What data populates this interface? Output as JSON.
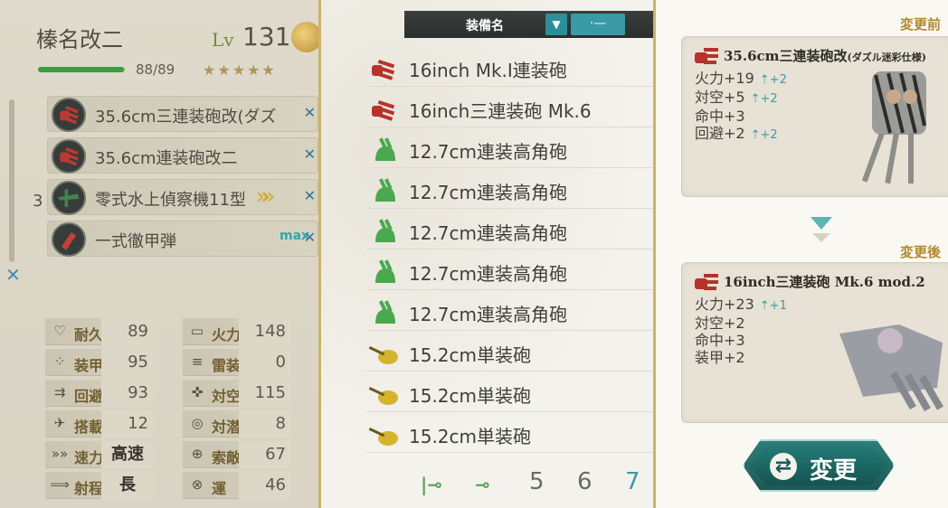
{
  "ship": {
    "name": "榛名改二",
    "lv_label": "Lv",
    "level": "131",
    "hp": "88/89",
    "hp_fraction": 0.989,
    "stars": "★★★★★",
    "slot_count": "3",
    "equipment": [
      {
        "name": "35.6cm三連装砲改(ダズ",
        "icon": "large-main-gun-icon",
        "mark": "✕"
      },
      {
        "name": "35.6cm連装砲改二",
        "icon": "large-main-gun-icon",
        "mark": "✕"
      },
      {
        "name": "零式水上偵察機11型",
        "icon": "seaplane-icon",
        "mark": "✕",
        "proficiency": "»»"
      },
      {
        "name": "一式徹甲弾",
        "icon": "ap-shell-icon",
        "mark": "✕",
        "badge": "max"
      }
    ],
    "stats_left": [
      {
        "label": "耐久",
        "value": "89",
        "icon": "heart-icon",
        "glyph": "♡"
      },
      {
        "label": "装甲",
        "value": "95",
        "icon": "armor-icon",
        "glyph": "⁘"
      },
      {
        "label": "回避",
        "value": "93",
        "icon": "evasion-icon",
        "glyph": "⇉"
      },
      {
        "label": "搭載",
        "value": "12",
        "icon": "aircraft-icon",
        "glyph": "✈"
      },
      {
        "label": "速力",
        "value": "高速",
        "icon": "speed-icon",
        "glyph": "»»"
      },
      {
        "label": "射程",
        "value": "長",
        "icon": "range-icon",
        "glyph": "⟹"
      }
    ],
    "stats_right": [
      {
        "label": "火力",
        "value": "148",
        "icon": "firepower-icon",
        "glyph": "▭"
      },
      {
        "label": "雷装",
        "value": "0",
        "icon": "torpedo-icon",
        "glyph": "≡"
      },
      {
        "label": "対空",
        "value": "115",
        "icon": "anti-air-icon",
        "glyph": "✜"
      },
      {
        "label": "対潜",
        "value": "8",
        "icon": "asw-icon",
        "glyph": "◎"
      },
      {
        "label": "索敵",
        "value": "67",
        "icon": "los-icon",
        "glyph": "⊕"
      },
      {
        "label": "運",
        "value": "46",
        "icon": "luck-icon",
        "glyph": "⊗"
      }
    ]
  },
  "list": {
    "header_label": "装備名",
    "sort_glyph": "▼",
    "filter_glyph": "·—",
    "items": [
      {
        "name": "16inch Mk.I連装砲",
        "color": "#b8322c",
        "icon": "large-main-gun-icon",
        "extra": ""
      },
      {
        "name": "16inch三連装砲 Mk.6",
        "color": "#b8322c",
        "icon": "large-main-gun-icon",
        "extra": "s"
      },
      {
        "name": "12.7cm連装高角砲",
        "color": "#4aa84f",
        "icon": "secondary-aa-gun-icon",
        "extra": ""
      },
      {
        "name": "12.7cm連装高角砲",
        "color": "#4aa84f",
        "icon": "secondary-aa-gun-icon",
        "extra": ""
      },
      {
        "name": "12.7cm連装高角砲",
        "color": "#4aa84f",
        "icon": "secondary-aa-gun-icon",
        "extra": ""
      },
      {
        "name": "12.7cm連装高角砲",
        "color": "#4aa84f",
        "icon": "secondary-aa-gun-icon",
        "extra": ""
      },
      {
        "name": "12.7cm連装高角砲",
        "color": "#4aa84f",
        "icon": "secondary-aa-gun-icon",
        "extra": ""
      },
      {
        "name": "15.2cm単装砲",
        "color": "#d4b42a",
        "icon": "secondary-gun-icon",
        "extra": ""
      },
      {
        "name": "15.2cm単装砲",
        "color": "#d4b42a",
        "icon": "secondary-gun-icon",
        "extra": ""
      },
      {
        "name": "15.2cm単装砲",
        "color": "#d4b42a",
        "icon": "secondary-gun-icon",
        "extra": ""
      }
    ],
    "pager": {
      "first_glyph": "|⊸",
      "prev_glyph": "⊸",
      "pages": [
        "5",
        "6",
        "7"
      ],
      "current": "7"
    }
  },
  "detail": {
    "before_label": "変更前",
    "after_label": "変更後",
    "before": {
      "name": "35.6cm三連装砲改",
      "name_suffix": "(ダズル迷彩仕様)",
      "icon": "large-main-gun-icon",
      "stats": [
        {
          "text": "火力+19",
          "up": "⇡+2"
        },
        {
          "text": "対空+5",
          "up": "⇡+2"
        },
        {
          "text": "命中+3",
          "up": ""
        },
        {
          "text": "回避+2",
          "up": "⇡+2"
        }
      ]
    },
    "after": {
      "name": "16inch三連装砲 Mk.6 mod.2",
      "icon": "large-main-gun-icon",
      "stats": [
        {
          "text": "火力+23",
          "up": "⇡+1"
        },
        {
          "text": "対空+2",
          "up": ""
        },
        {
          "text": "命中+3",
          "up": ""
        },
        {
          "text": "装甲+2",
          "up": ""
        }
      ]
    },
    "change_button": {
      "icon_glyph": "⇄",
      "label": "変更"
    }
  },
  "colors": {
    "accent_teal": "#3a9aa5",
    "gold_border": "#c9b46a",
    "main_gun_red": "#b8322c",
    "aa_gun_green": "#4aa84f",
    "secondary_gun_yellow": "#d4b42a"
  }
}
